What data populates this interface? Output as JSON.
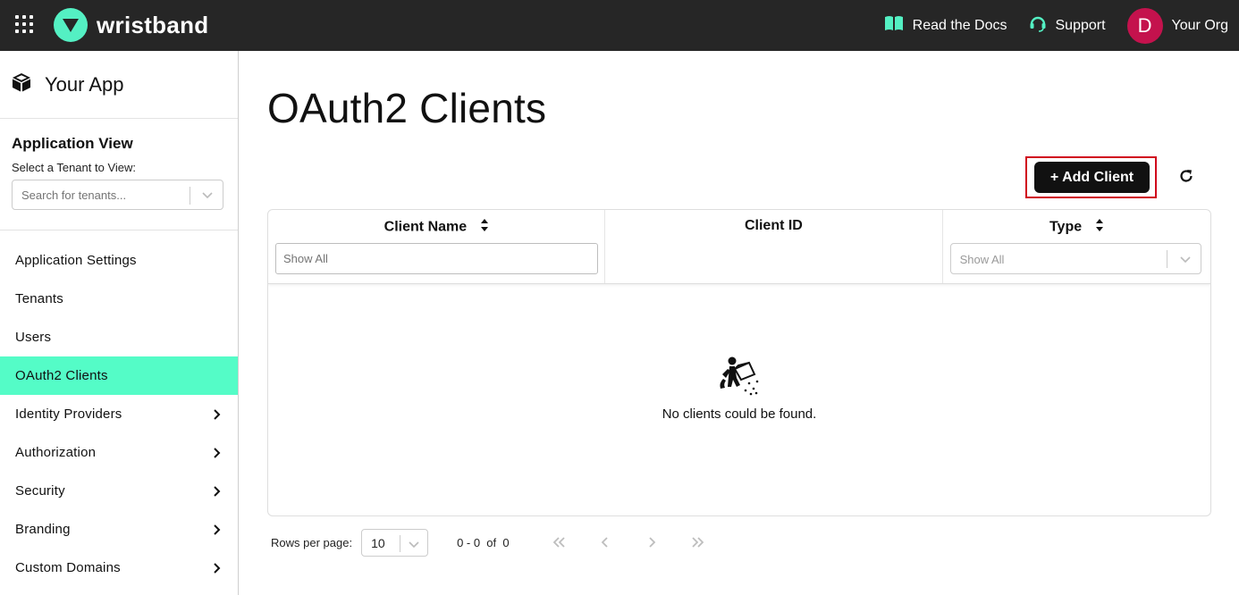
{
  "header": {
    "brand": "wristband",
    "docs_label": "Read the Docs",
    "support_label": "Support",
    "avatar_initial": "D",
    "org_name": "Your Org",
    "accent_color": "#54f0c3"
  },
  "sidebar": {
    "app_name": "Your App",
    "app_view_title": "Application View",
    "tenant_label": "Select a Tenant to View:",
    "tenant_placeholder": "Search for tenants...",
    "items": [
      {
        "label": "Application Settings",
        "active": false,
        "has_chevron": false
      },
      {
        "label": "Tenants",
        "active": false,
        "has_chevron": false
      },
      {
        "label": "Users",
        "active": false,
        "has_chevron": false
      },
      {
        "label": "OAuth2 Clients",
        "active": true,
        "has_chevron": false
      },
      {
        "label": "Identity Providers",
        "active": false,
        "has_chevron": true
      },
      {
        "label": "Authorization",
        "active": false,
        "has_chevron": true
      },
      {
        "label": "Security",
        "active": false,
        "has_chevron": true
      },
      {
        "label": "Branding",
        "active": false,
        "has_chevron": true
      },
      {
        "label": "Custom Domains",
        "active": false,
        "has_chevron": true
      }
    ]
  },
  "main": {
    "title": "OAuth2 Clients",
    "add_button_label": "+ Add Client",
    "table": {
      "columns": [
        {
          "label": "Client Name",
          "sortable": true,
          "filter": "Show All"
        },
        {
          "label": "Client ID",
          "sortable": false,
          "filter": ""
        },
        {
          "label": "Type",
          "sortable": true,
          "filter": "Show All"
        }
      ],
      "empty_message": "No clients could be found."
    },
    "pagination": {
      "rows_label": "Rows per page:",
      "rows_value": "10",
      "range_text": "0 - 0  of  0"
    }
  }
}
